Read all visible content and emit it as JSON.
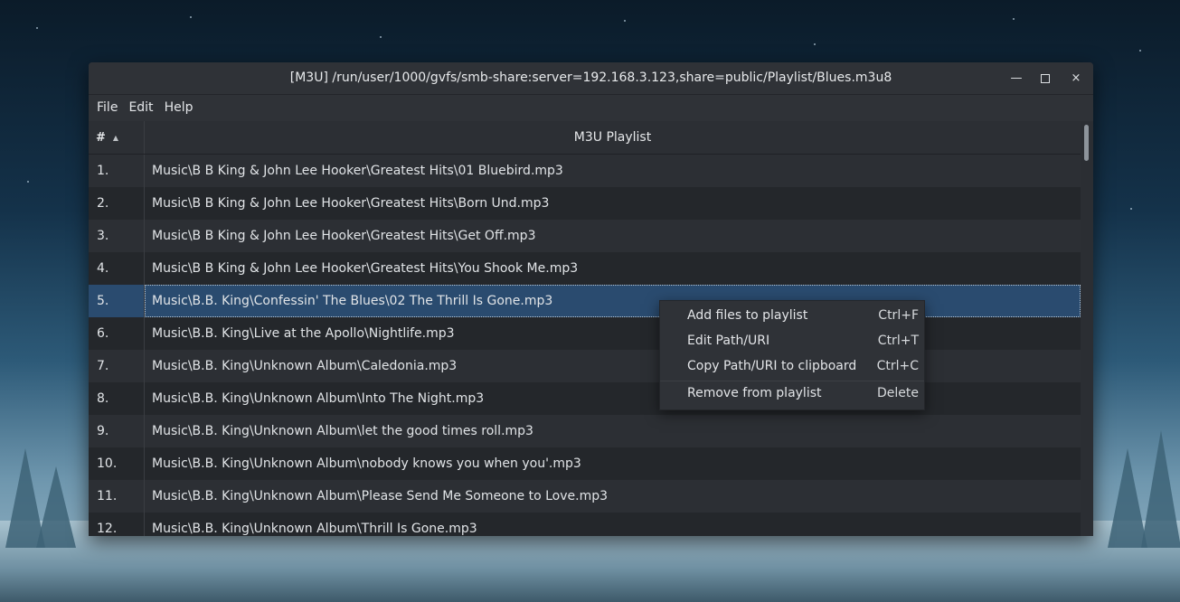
{
  "window": {
    "title": "[M3U] /run/user/1000/gvfs/smb-share:server=192.168.3.123,share=public/Playlist/Blues.m3u8",
    "minimize": "—",
    "close": "×"
  },
  "menubar": {
    "items": [
      "File",
      "Edit",
      "Help"
    ]
  },
  "table": {
    "num_header": "#",
    "name_header": "M3U Playlist",
    "rows": [
      {
        "num": "1.",
        "path": "Music\\B B King & John Lee Hooker\\Greatest Hits\\01 Bluebird.mp3"
      },
      {
        "num": "2.",
        "path": "Music\\B B King & John Lee Hooker\\Greatest Hits\\Born Und.mp3"
      },
      {
        "num": "3.",
        "path": "Music\\B B King & John Lee Hooker\\Greatest Hits\\Get Off.mp3"
      },
      {
        "num": "4.",
        "path": "Music\\B B King & John Lee Hooker\\Greatest Hits\\You Shook Me.mp3"
      },
      {
        "num": "5.",
        "path": "Music\\B.B. King\\Confessin' The Blues\\02 The Thrill Is Gone.mp3"
      },
      {
        "num": "6.",
        "path": "Music\\B.B. King\\Live at the Apollo\\Nightlife.mp3"
      },
      {
        "num": "7.",
        "path": "Music\\B.B. King\\Unknown Album\\Caledonia.mp3"
      },
      {
        "num": "8.",
        "path": "Music\\B.B. King\\Unknown Album\\Into The Night.mp3"
      },
      {
        "num": "9.",
        "path": "Music\\B.B. King\\Unknown Album\\let the good times roll.mp3"
      },
      {
        "num": "10.",
        "path": "Music\\B.B. King\\Unknown Album\\nobody knows you when you'.mp3"
      },
      {
        "num": "11.",
        "path": "Music\\B.B. King\\Unknown Album\\Please Send Me Someone to Love.mp3"
      },
      {
        "num": "12.",
        "path": "Music\\B.B. King\\Unknown Album\\Thrill Is Gone.mp3"
      }
    ]
  },
  "context_menu": {
    "items": [
      {
        "label": "Add files to playlist",
        "shortcut": "Ctrl+F"
      },
      {
        "label": "Edit Path/URI",
        "shortcut": "Ctrl+T"
      },
      {
        "label": "Copy Path/URI to clipboard",
        "shortcut": "Ctrl+C"
      },
      {
        "label": "Remove from playlist",
        "shortcut": "Delete"
      }
    ]
  },
  "colors": {
    "selection": "#2a4b6f",
    "window_bg": "#2b2e33"
  },
  "icons": [
    "sort-ascending-icon",
    "minimize-icon",
    "maximize-icon",
    "close-icon"
  ]
}
